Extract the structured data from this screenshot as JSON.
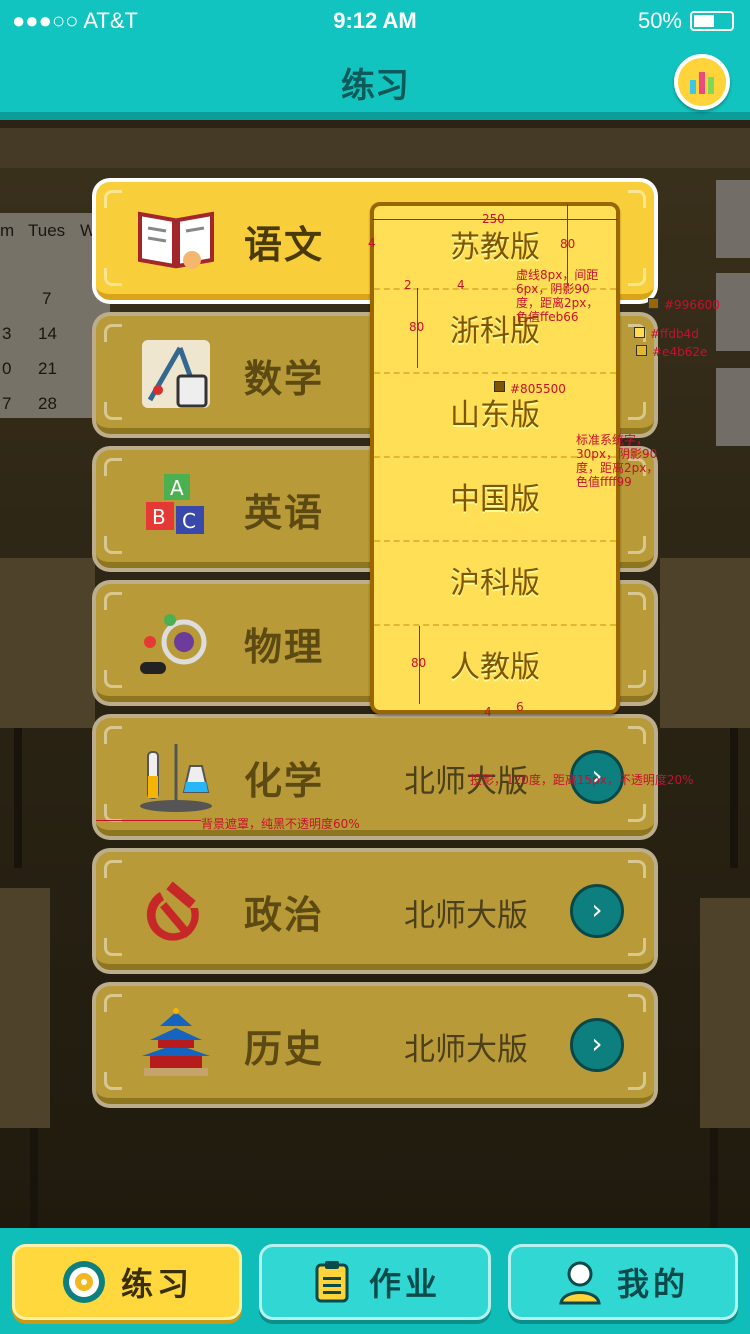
{
  "status": {
    "signal": "●●●○○ AT&T",
    "time": "9:12 AM",
    "battery": "50%"
  },
  "nav": {
    "title": "练习",
    "chart_icon": "bar-chart-icon"
  },
  "calendar": {
    "header": [
      "m",
      "Tues",
      "W"
    ],
    "rows": [
      [
        "",
        "7"
      ],
      [
        "3",
        "14"
      ],
      [
        "0",
        "21"
      ],
      [
        "7",
        "28"
      ]
    ]
  },
  "subjects": [
    {
      "name": "语文",
      "edition": "",
      "icon": "open-book-icon",
      "active": true
    },
    {
      "name": "数学",
      "edition": "",
      "icon": "math-tools-icon"
    },
    {
      "name": "英语",
      "edition": "",
      "icon": "abc-blocks-icon"
    },
    {
      "name": "物理",
      "edition": "",
      "icon": "atom-icon"
    },
    {
      "name": "化学",
      "edition": "北师大版",
      "icon": "lab-flask-icon"
    },
    {
      "name": "政治",
      "edition": "北师大版",
      "icon": "hammer-sickle-icon"
    },
    {
      "name": "历史",
      "edition": "北师大版",
      "icon": "temple-icon"
    }
  ],
  "dropdown": {
    "options": [
      "苏教版",
      "浙科版",
      "山东版",
      "中国版",
      "沪科版",
      "人教版"
    ]
  },
  "annotations": {
    "width": "250",
    "h80a": "80",
    "h80b": "80",
    "h80c": "80",
    "n4a": "4",
    "n2": "2",
    "n4b": "4",
    "n4c": "4",
    "n6": "6",
    "dashed": [
      "虚线8px，间距",
      "6px，阴影90",
      "度，距离2px，",
      "色值ffeb66"
    ],
    "c1": "#996600",
    "c2": "#ffdb4d",
    "c3": "#e4b62e",
    "c4": "#805500",
    "font": [
      "标准系统字，",
      "30px，阴影90",
      "度，距离2px，",
      "色值ffff99"
    ],
    "shadow": "投影，120度，距离15px，不透明度20%",
    "mask": "背景遮罩，纯黑不透明度60%"
  },
  "colors": {
    "accent": "#12c4bf",
    "card": "#f8cf3a",
    "dropdown": "#ffdf56",
    "border": "#996600",
    "text": "#805500"
  },
  "tabs": [
    {
      "label": "练习",
      "icon": "target-icon",
      "active": true
    },
    {
      "label": "作业",
      "icon": "clipboard-icon"
    },
    {
      "label": "我的",
      "icon": "user-icon"
    }
  ]
}
